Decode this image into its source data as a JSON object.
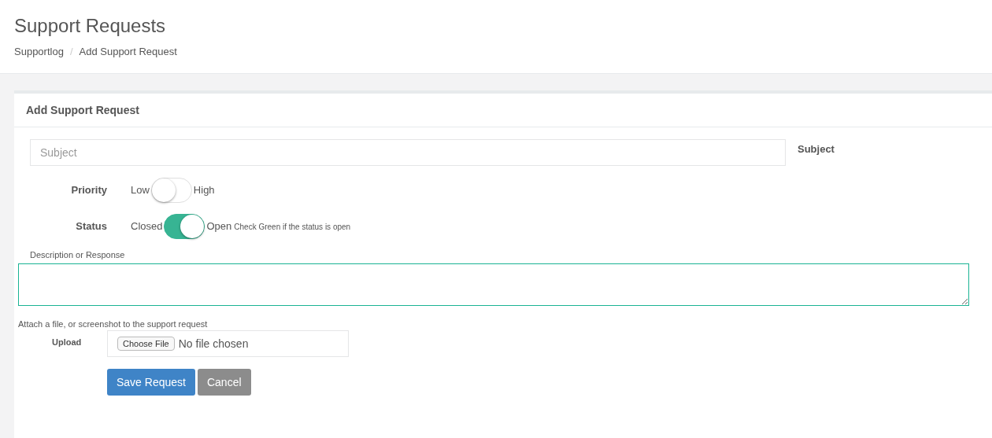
{
  "page": {
    "title": "Support Requests"
  },
  "breadcrumb": [
    {
      "label": "Supportlog"
    },
    {
      "label": "Add Support Request"
    }
  ],
  "separator": "/",
  "card": {
    "title": "Add Support Request"
  },
  "subject": {
    "placeholder": "Subject",
    "label": "Subject"
  },
  "toggles": [
    {
      "label": "Priority",
      "off_label": "Low",
      "on_label": "High",
      "on": false
    },
    {
      "label": "Status",
      "off_label": "Closed",
      "on_label": "Open",
      "on": true,
      "hint": "Check Green if the status is open"
    }
  ],
  "description": {
    "label": "Description or Response",
    "focused": true
  },
  "attach": {
    "caption": "Attach a file, or screenshot to the support request",
    "label": "Upload",
    "button": "Choose File",
    "status": "No file chosen"
  },
  "buttons": [
    {
      "label": "Save Request",
      "kind": "primary"
    },
    {
      "label": "Cancel",
      "kind": "disabled"
    }
  ]
}
